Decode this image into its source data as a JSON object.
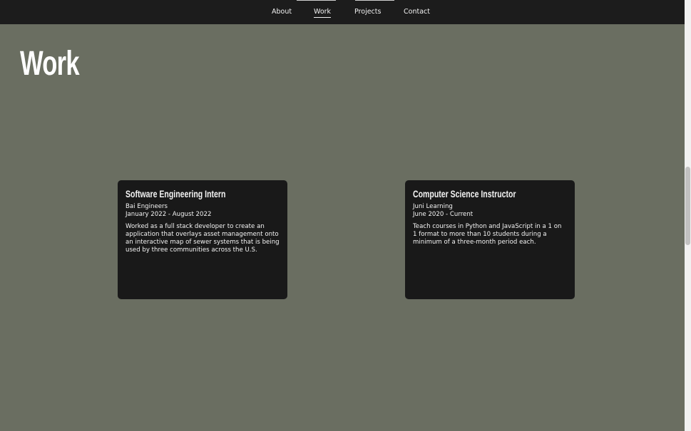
{
  "nav": {
    "items": [
      {
        "label": "About"
      },
      {
        "label": "Work"
      },
      {
        "label": "Projects"
      },
      {
        "label": "Contact"
      }
    ],
    "active": "Work"
  },
  "main": {
    "heading": "Work"
  },
  "jobs": [
    {
      "title": "Software Engineering Intern",
      "company": "Bai Engineers",
      "dates": "January 2022 - August 2022",
      "description": "Worked as a full stack developer to create an application that overlays asset management onto an interactive map of sewer systems that is being used by three communities across the U.S."
    },
    {
      "title": "Computer Science Instructor",
      "company": "Juni Learning",
      "dates": "June 2020 - Current",
      "description": "Teach courses in Python and JavaScript in a 1 on 1 format to more than 10 students during a minimum of a three-month period each."
    }
  ],
  "colors": {
    "page_bg": "#6a6e61",
    "nav_bg": "#1c1c1c",
    "card_bg": "#191919",
    "text": "#ffffff"
  }
}
